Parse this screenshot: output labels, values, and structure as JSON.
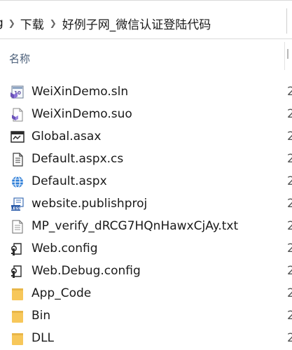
{
  "breadcrumb": {
    "partial_label": "g",
    "items": [
      "下载",
      "好例子网_微信认证登陆代码"
    ]
  },
  "columns": {
    "name_header": "名称"
  },
  "files": [
    {
      "name": "WeiXinDemo.sln",
      "icon": "solution-file-icon",
      "date_partial": "2"
    },
    {
      "name": "WeiXinDemo.suo",
      "icon": "suo-file-icon",
      "date_partial": "2"
    },
    {
      "name": "Global.asax",
      "icon": "asax-file-icon",
      "date_partial": "2"
    },
    {
      "name": "Default.aspx.cs",
      "icon": "cs-file-icon",
      "date_partial": "2"
    },
    {
      "name": "Default.aspx",
      "icon": "aspx-file-icon",
      "date_partial": "2"
    },
    {
      "name": "website.publishproj",
      "icon": "publishproj-file-icon",
      "date_partial": "2"
    },
    {
      "name": "MP_verify_dRCG7HQnHawxCjAy.txt",
      "icon": "text-file-icon",
      "date_partial": "2"
    },
    {
      "name": "Web.config",
      "icon": "config-file-icon",
      "date_partial": "2"
    },
    {
      "name": "Web.Debug.config",
      "icon": "config-file-icon",
      "date_partial": "2"
    },
    {
      "name": "App_Code",
      "icon": "folder-icon",
      "date_partial": "2"
    },
    {
      "name": "Bin",
      "icon": "folder-icon",
      "date_partial": "2"
    },
    {
      "name": "DLL",
      "icon": "folder-icon",
      "date_partial": "2"
    }
  ],
  "colors": {
    "folder": "#f7c75a",
    "header_text": "#4c607a",
    "aspx_globe": "#2f7fd8"
  }
}
